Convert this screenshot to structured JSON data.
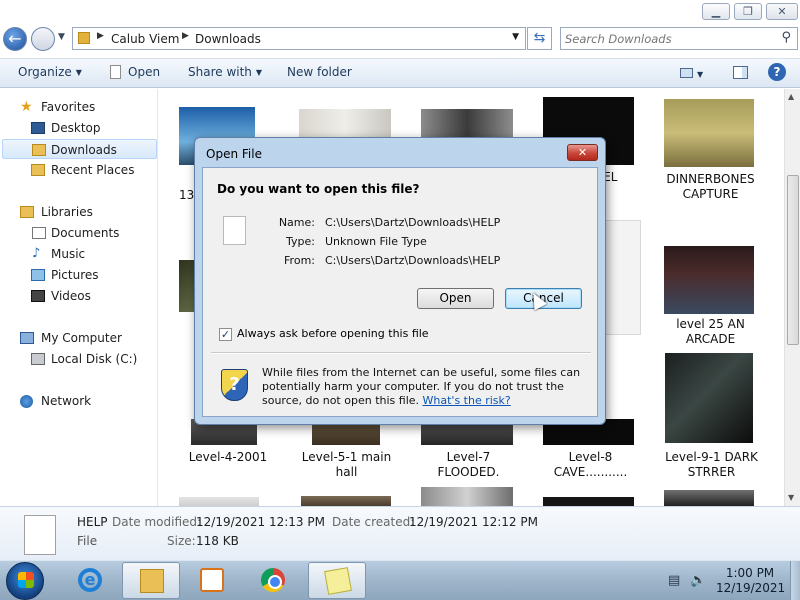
{
  "explorer": {
    "breadcrumb": [
      "Calub Viem",
      "Downloads"
    ],
    "search_placeholder": "Search Downloads",
    "toolbar": {
      "organize": "Organize",
      "open": "Open",
      "share_with": "Share with",
      "new_folder": "New folder"
    },
    "nav": {
      "favorites": "Favorites",
      "desktop": "Desktop",
      "downloads": "Downloads",
      "recent_places": "Recent Places",
      "libraries": "Libraries",
      "documents": "Documents",
      "music": "Music",
      "pictures": "Pictures",
      "videos": "Videos",
      "my_computer": "My Computer",
      "local_disk": "Local Disk (C:)",
      "network": "Network"
    },
    "files": {
      "partial_13": "13",
      "partial_vel": "VEL",
      "dinnerbones": [
        "DINNERBONES",
        "CAPTURE"
      ],
      "level25": [
        "level 25 AN",
        "ARCADE"
      ],
      "level4": "Level-4-2001",
      "level5": [
        "Level-5-1 main",
        "hall"
      ],
      "level7": [
        "Level-7",
        "FLOODED."
      ],
      "level8": [
        "Level-8",
        "CAVE..........."
      ],
      "level9": [
        "Level-9-1 DARK",
        "STRRER"
      ]
    },
    "details": {
      "name": "HELP",
      "type": "File",
      "modified_label": "Date modified:",
      "modified": "12/19/2021 12:13 PM",
      "created_label": "Date created:",
      "created": "12/19/2021 12:12 PM",
      "size_label": "Size:",
      "size": "118 KB"
    }
  },
  "dialog": {
    "title": "Open File",
    "question": "Do you want to open this file?",
    "name_label": "Name:",
    "name": "C:\\Users\\Dartz\\Downloads\\HELP",
    "type_label": "Type:",
    "type": "Unknown File Type",
    "from_label": "From:",
    "from": "C:\\Users\\Dartz\\Downloads\\HELP",
    "open": "Open",
    "cancel": "Cancel",
    "always_ask": "Always ask before opening this file",
    "warning": "While files from the Internet can be useful, some files can potentially harm your computer. If you do not trust the source, do not open this file.",
    "risk_link": "What's the risk?"
  },
  "taskbar": {
    "time": "1:00 PM",
    "date": "12/19/2021"
  },
  "icons": {
    "start": "windows-start-icon",
    "ie": "internet-explorer-icon",
    "explorer": "folder-icon",
    "media": "media-player-icon",
    "chrome": "chrome-icon",
    "sticky": "sticky-notes-icon"
  }
}
